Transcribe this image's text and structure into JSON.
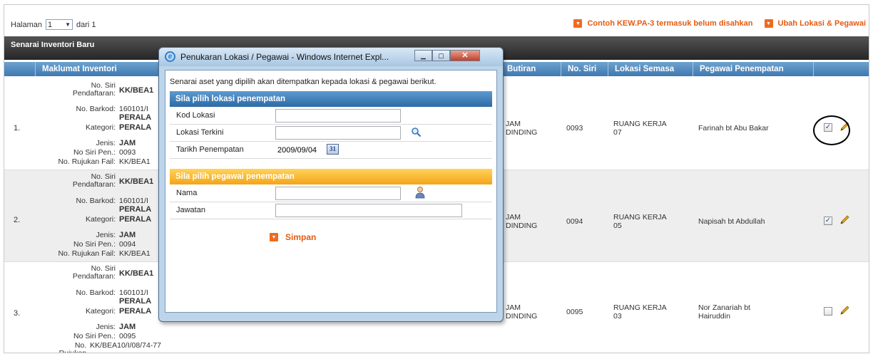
{
  "paging": {
    "label": "Halaman",
    "current": "1",
    "suffix": "dari 1"
  },
  "actions": [
    {
      "label": "Contoh KEW.PA-3 termasuk belum disahkan"
    },
    {
      "label": "Ubah Lokasi & Pegawai"
    }
  ],
  "section_title": "Senarai Inventori Baru",
  "table": {
    "headers": {
      "info": "Maklumat Inventori",
      "butiran": "Butiran",
      "siri": "No. Siri",
      "lokasi": "Lokasi Semasa",
      "pegawai": "Pegawai Penempatan"
    },
    "meta_labels": {
      "siri_pendaftaran_1": "No. Siri",
      "siri_pendaftaran_2": "Pendaftaran:",
      "barkod": "No. Barkod:",
      "kategori": "Kategori:",
      "jenis": "Jenis:",
      "siri_pen": "No Siri Pen.:",
      "rujukan": "No. Rujukan Fail:"
    },
    "rows": [
      {
        "num": "1.",
        "pendaftaran": "KK/BEA1",
        "barkod": "160101/I",
        "kategori1": "PERALA",
        "kategori2": "PERALA",
        "jenis": "JAM",
        "siri_pen": "0093",
        "rujukan": "KK/BEA1",
        "butiran": "JAM DINDING",
        "siri": "0093",
        "lokasi": "RUANG KERJA 07",
        "pegawai": "Farinah bt Abu Bakar",
        "checked": "✓"
      },
      {
        "num": "2.",
        "pendaftaran": "KK/BEA1",
        "barkod": "160101/I",
        "kategori1": "PERALA",
        "kategori2": "PERALA",
        "jenis": "JAM",
        "siri_pen": "0094",
        "rujukan": "KK/BEA1",
        "butiran": "JAM DINDING",
        "siri": "0094",
        "lokasi": "RUANG KERJA 05",
        "pegawai": "Napisah bt Abdullah",
        "checked": "✓"
      },
      {
        "num": "3.",
        "pendaftaran": "KK/BEA1",
        "barkod": "160101/I",
        "kategori1": "PERALA",
        "kategori2": "PERALA",
        "jenis": "JAM",
        "siri_pen": "0095",
        "rujukan": "KK/BEA10/I/08/74-77",
        "butiran": "JAM DINDING",
        "siri": "0095",
        "lokasi": "RUANG KERJA 03",
        "pegawai": "Nor Zanariah bt Hairuddin",
        "checked": ""
      }
    ]
  },
  "dialog": {
    "title": "Penukaran Lokasi / Pegawai - Windows Internet Expl...",
    "intro": "Senarai aset yang dipilih akan ditempatkan kepada lokasi & pegawai berikut.",
    "location_section": "Sila pilih lokasi penempatan",
    "kod_lokasi_label": "Kod Lokasi",
    "kod_lokasi_value": "",
    "lokasi_terkini_label": "Lokasi Terkini",
    "lokasi_terkini_value": "",
    "tarikh_label": "Tarikh Penempatan",
    "tarikh_value": "2009/09/04",
    "calendar_glyph": "31",
    "officer_section": "Sila pilih pegawai penempatan",
    "nama_label": "Nama",
    "nama_value": "",
    "jawatan_label": "Jawatan",
    "jawatan_value": "",
    "save_label": "Simpan"
  },
  "icons": {
    "orange_arrow": "orange-arrow-icon",
    "search": "search-icon",
    "calendar": "calendar-icon",
    "user": "user-icon",
    "pencil": "pencil-icon"
  },
  "colors": {
    "accent_orange": "#e45b10",
    "header_blue": "#3f79b0",
    "section_orange": "#f3a418"
  }
}
